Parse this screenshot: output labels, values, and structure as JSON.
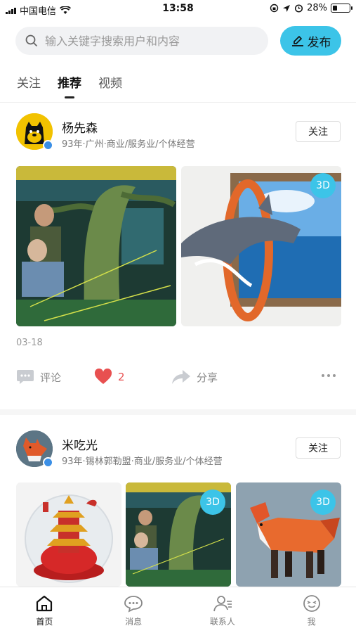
{
  "status_bar": {
    "carrier": "中国电信",
    "time": "13:58",
    "battery": "28%",
    "battery_level": 0.28
  },
  "header": {
    "search_placeholder": "输入关键字搜索用户和内容",
    "publish_label": "发布"
  },
  "tabs": [
    {
      "label": "关注"
    },
    {
      "label": "推荐",
      "active": true
    },
    {
      "label": "视频"
    }
  ],
  "posts": [
    {
      "name": "杨先森",
      "meta": "93年·广州·商业/服务业/个体经营",
      "follow_label": "关注",
      "date": "03-18",
      "images": [
        {
          "scene": "jungle-lab"
        },
        {
          "scene": "dolphin-frame",
          "badge": "3D"
        }
      ],
      "actions": {
        "comment": "评论",
        "likes": "2",
        "share": "分享"
      }
    },
    {
      "name": "米吃光",
      "meta": "93年·锡林郭勒盟·商业/服务业/个体经营",
      "follow_label": "关注",
      "images": [
        {
          "scene": "pagoda-globe"
        },
        {
          "scene": "jungle-lab",
          "badge": "3D"
        },
        {
          "scene": "paper-fox",
          "badge": "3D"
        }
      ]
    }
  ],
  "bottom_nav": [
    {
      "label": "首页",
      "icon": "home-icon",
      "active": true
    },
    {
      "label": "消息",
      "icon": "message-icon"
    },
    {
      "label": "联系人",
      "icon": "contacts-icon"
    },
    {
      "label": "我",
      "icon": "profile-icon"
    }
  ],
  "colors": {
    "accent": "#3cc4e8",
    "like": "#e85050",
    "verified": "#3b8fe6"
  }
}
